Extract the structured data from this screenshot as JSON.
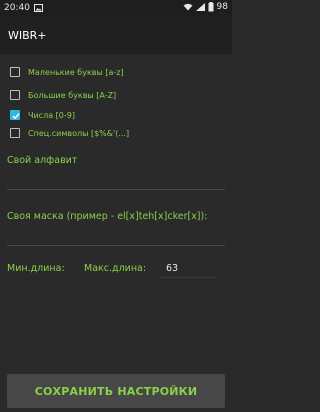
{
  "status_bar": {
    "time": "20:40",
    "battery": "98"
  },
  "app": {
    "title": "WIBR+"
  },
  "options": [
    {
      "label": "Маленькие буквы [a-z]",
      "checked": false
    },
    {
      "label": "Большие буквы [A-Z]",
      "checked": false
    },
    {
      "label": "Числа [0-9]",
      "checked": true
    },
    {
      "label": "Спец.символы [$%&'(...]",
      "checked": false
    }
  ],
  "custom_alphabet": {
    "label": "Свой алфавит",
    "value": ""
  },
  "custom_mask": {
    "label": "Своя маска (пример - el[x]teh[x]cker[x]):",
    "value": ""
  },
  "lengths": {
    "min_label": "Мин.длина:",
    "min_value": "",
    "max_label": "Макс.длина:",
    "max_value": "63"
  },
  "save_button": {
    "label": "СОХРАНИТЬ НАСТРОЙКИ"
  },
  "colors": {
    "accent_green": "#8bd14a",
    "checkbox_blue": "#33b5e5",
    "background": "#2a2a2a"
  }
}
